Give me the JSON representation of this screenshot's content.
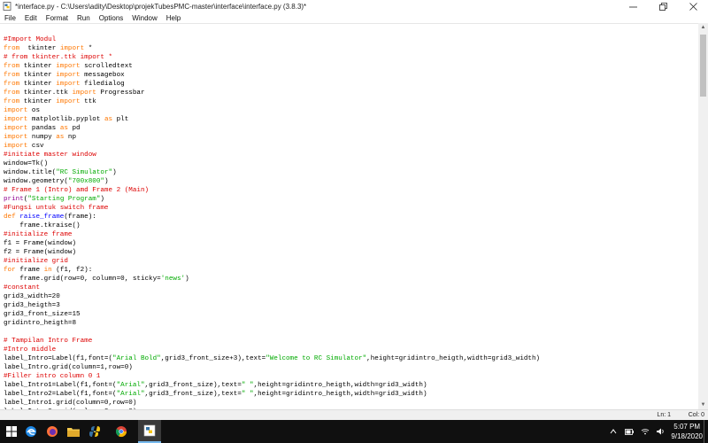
{
  "window": {
    "title": "*interface.py - C:\\Users\\adity\\Desktop\\projekTubesPMC-master\\interface\\interface.py (3.8.3)*",
    "controls": [
      "minimize",
      "maximize",
      "close"
    ]
  },
  "menu": [
    "File",
    "Edit",
    "Format",
    "Run",
    "Options",
    "Window",
    "Help"
  ],
  "code_lines": [
    [
      [
        "cm",
        "#Import Modul"
      ]
    ],
    [
      [
        "kw",
        "from"
      ],
      [
        "",
        "  tkinter "
      ],
      [
        "kw",
        "import"
      ],
      [
        "",
        " *"
      ]
    ],
    [
      [
        "cm",
        "# from tkinter.ttk import *"
      ]
    ],
    [
      [
        "kw",
        "from"
      ],
      [
        "",
        " tkinter "
      ],
      [
        "kw",
        "import"
      ],
      [
        "",
        " scrolledtext"
      ]
    ],
    [
      [
        "kw",
        "from"
      ],
      [
        "",
        " tkinter "
      ],
      [
        "kw",
        "import"
      ],
      [
        "",
        " messagebox"
      ]
    ],
    [
      [
        "kw",
        "from"
      ],
      [
        "",
        " tkinter "
      ],
      [
        "kw",
        "import"
      ],
      [
        "",
        " filedialog"
      ]
    ],
    [
      [
        "kw",
        "from"
      ],
      [
        "",
        " tkinter.ttk "
      ],
      [
        "kw",
        "import"
      ],
      [
        "",
        " Progressbar"
      ]
    ],
    [
      [
        "kw",
        "from"
      ],
      [
        "",
        " tkinter "
      ],
      [
        "kw",
        "import"
      ],
      [
        "",
        " ttk"
      ]
    ],
    [
      [
        "kw",
        "import"
      ],
      [
        "",
        " os"
      ]
    ],
    [
      [
        "kw",
        "import"
      ],
      [
        "",
        " matplotlib.pyplot "
      ],
      [
        "kw",
        "as"
      ],
      [
        "",
        " plt"
      ]
    ],
    [
      [
        "kw",
        "import"
      ],
      [
        "",
        " pandas "
      ],
      [
        "kw",
        "as"
      ],
      [
        "",
        " pd"
      ]
    ],
    [
      [
        "kw",
        "import"
      ],
      [
        "",
        " numpy "
      ],
      [
        "kw",
        "as"
      ],
      [
        "",
        " np"
      ]
    ],
    [
      [
        "kw",
        "import"
      ],
      [
        "",
        " csv"
      ]
    ],
    [
      [
        "cm",
        "#initiate master window"
      ]
    ],
    [
      [
        "",
        "window=Tk()"
      ]
    ],
    [
      [
        "",
        "window.title("
      ],
      [
        "st",
        "\"RC Simulator\""
      ],
      [
        "",
        ")"
      ]
    ],
    [
      [
        "",
        "window.geometry("
      ],
      [
        "st",
        "\"700x800\""
      ],
      [
        "",
        ")"
      ]
    ],
    [
      [
        "cm",
        "# Frame 1 (Intro) amd Frame 2 (Main)"
      ]
    ],
    [
      [
        "bi",
        "print"
      ],
      [
        "",
        "("
      ],
      [
        "st",
        "\"Starting Program\""
      ],
      [
        "",
        ")"
      ]
    ],
    [
      [
        "cm",
        "#Fungsi untuk switch frame"
      ]
    ],
    [
      [
        "kw",
        "def"
      ],
      [
        "",
        " "
      ],
      [
        "df",
        "raise_frame"
      ],
      [
        "",
        "(frame):"
      ]
    ],
    [
      [
        "",
        "    frame.tkraise()"
      ]
    ],
    [
      [
        "cm",
        "#initialize frame"
      ]
    ],
    [
      [
        "",
        "f1 = Frame(window)"
      ]
    ],
    [
      [
        "",
        "f2 = Frame(window)"
      ]
    ],
    [
      [
        "cm",
        "#initialize grid"
      ]
    ],
    [
      [
        "kw",
        "for"
      ],
      [
        "",
        " frame "
      ],
      [
        "kw",
        "in"
      ],
      [
        "",
        " (f1, f2):"
      ]
    ],
    [
      [
        "",
        "    frame.grid(row=0, column=0, sticky="
      ],
      [
        "st",
        "'news'"
      ],
      [
        "",
        ")"
      ]
    ],
    [
      [
        "cm",
        "#constant"
      ]
    ],
    [
      [
        "",
        "grid3_width=20"
      ]
    ],
    [
      [
        "",
        "grid3_heigth=3"
      ]
    ],
    [
      [
        "",
        "grid3_front_size=15"
      ]
    ],
    [
      [
        "",
        "gridintro_heigth=8"
      ]
    ],
    [
      [
        "",
        ""
      ]
    ],
    [
      [
        "cm",
        "# Tampilan Intro Frame"
      ]
    ],
    [
      [
        "cm",
        "#Intro middle"
      ]
    ],
    [
      [
        "",
        "label_Intro=Label(f1,font=("
      ],
      [
        "st",
        "\"Arial Bold\""
      ],
      [
        "",
        ",grid3_front_size+3),text="
      ],
      [
        "st",
        "\"Welcome to RC Simulator\""
      ],
      [
        "",
        ",height=gridintro_heigth,width=grid3_width)"
      ]
    ],
    [
      [
        "",
        "label_Intro.grid(column=1,row=0)"
      ]
    ],
    [
      [
        "cm",
        "#Filler intro column 0 1"
      ]
    ],
    [
      [
        "",
        "label_Intro1=Label(f1,font=("
      ],
      [
        "st",
        "\"Arial\""
      ],
      [
        "",
        ",grid3_front_size),text="
      ],
      [
        "st",
        "\" \""
      ],
      [
        "",
        ",height=gridintro_heigth,width=grid3_width)"
      ]
    ],
    [
      [
        "",
        "label_Intro2=Label(f1,font=("
      ],
      [
        "st",
        "\"Arial\""
      ],
      [
        "",
        ",grid3_front_size),text="
      ],
      [
        "st",
        "\" \""
      ],
      [
        "",
        ",height=gridintro_heigth,width=grid3_width)"
      ]
    ],
    [
      [
        "",
        "label_Intro1.grid(column=0,row=0)"
      ]
    ],
    [
      [
        "",
        "label_Intro2.grid(column=2,row=0)"
      ]
    ]
  ],
  "status": {
    "line": "Ln: 1",
    "col": "Col: 0"
  },
  "taskbar": {
    "items": [
      "start",
      "edge",
      "firefox",
      "file-explorer",
      "python-idle",
      "chrome",
      "idle-editor"
    ],
    "time": "5:07 PM",
    "date": "9/18/2020"
  },
  "colors": {
    "keyword": "#ff7700",
    "comment": "#dd0000",
    "string": "#00aa00",
    "builtin": "#900090",
    "definition": "#0000ff"
  }
}
